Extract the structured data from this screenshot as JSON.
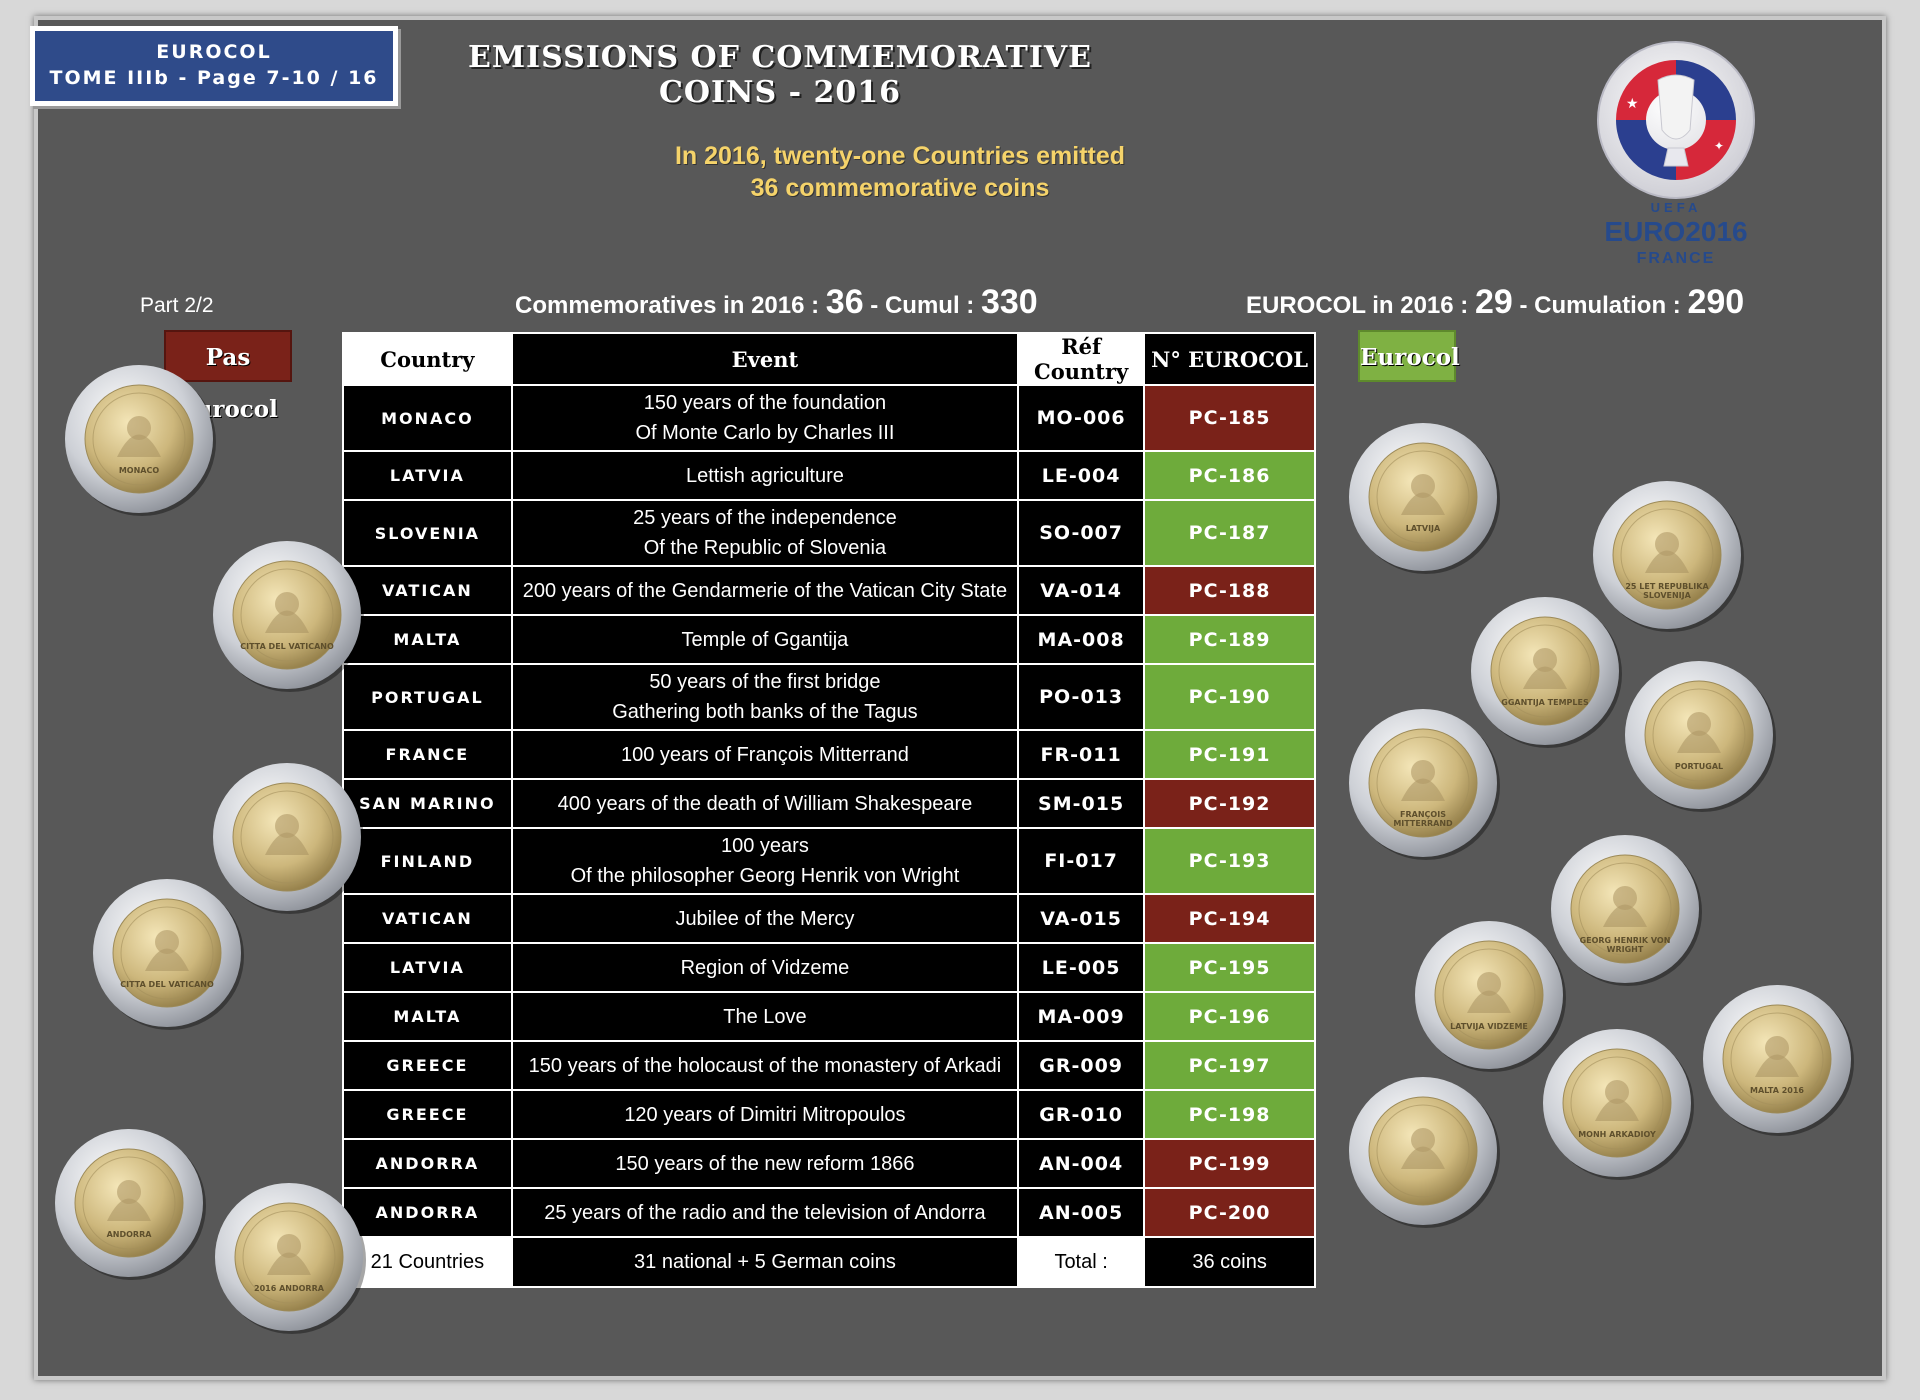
{
  "header": {
    "badge_line1": "EUROCOL",
    "badge_line2": "TOME IIIb - Page 7-10 / 16",
    "title": "EMISSIONS OF COMMEMORATIVE COINS - 2016",
    "intro_line1": "In 2016, twenty-one Countries emitted",
    "intro_line2": "36 commemorative coins",
    "logo_uefa": "UEFA",
    "logo_euro": "EURO2016",
    "logo_france": "FRANCE"
  },
  "summary": {
    "part": "Part 2/2",
    "comm_label": "Commemoratives in 2016 :",
    "comm_value": "36",
    "cumul_label": "- Cumul :",
    "cumul_value": "330",
    "eurocol_label": "EUROCOL in 2016 :",
    "eurocol_value": "29",
    "cumulation_label": "- Cumulation :",
    "cumulation_value": "290"
  },
  "tags": {
    "not_eurocol": "Pas Eurocol",
    "eurocol": "Eurocol"
  },
  "table": {
    "headers": {
      "country": "Country",
      "event": "Event",
      "ref": "Réf Country",
      "num": "N° EUROCOL"
    },
    "rows": [
      {
        "country": "MONACO",
        "event": [
          "150 years of the foundation",
          "Of Monte Carlo by Charles III"
        ],
        "ref": "MO-006",
        "num": "PC-185",
        "status": "red"
      },
      {
        "country": "LATVIA",
        "event": [
          "Lettish agriculture"
        ],
        "ref": "LE-004",
        "num": "PC-186",
        "status": "green"
      },
      {
        "country": "SLOVENIA",
        "event": [
          "25 years of the independence",
          "Of the Republic of Slovenia"
        ],
        "ref": "SO-007",
        "num": "PC-187",
        "status": "green"
      },
      {
        "country": "VATICAN",
        "event": [
          "200 years of the Gendarmerie of the Vatican City State"
        ],
        "ref": "VA-014",
        "num": "PC-188",
        "status": "red"
      },
      {
        "country": "MALTA",
        "event": [
          "Temple of Ggantija"
        ],
        "ref": "MA-008",
        "num": "PC-189",
        "status": "green"
      },
      {
        "country": "PORTUGAL",
        "event": [
          "50 years of the first bridge",
          "Gathering both banks of the Tagus"
        ],
        "ref": "PO-013",
        "num": "PC-190",
        "status": "green"
      },
      {
        "country": "FRANCE",
        "event": [
          "100 years of François Mitterrand"
        ],
        "ref": "FR-011",
        "num": "PC-191",
        "status": "green"
      },
      {
        "country": "SAN MARINO",
        "event": [
          "400 years of the death of William Shakespeare"
        ],
        "ref": "SM-015",
        "num": "PC-192",
        "status": "red"
      },
      {
        "country": "FINLAND",
        "event": [
          "100 years",
          "Of the philosopher Georg Henrik von Wright"
        ],
        "ref": "FI-017",
        "num": "PC-193",
        "status": "green"
      },
      {
        "country": "VATICAN",
        "event": [
          "Jubilee of the Mercy"
        ],
        "ref": "VA-015",
        "num": "PC-194",
        "status": "red"
      },
      {
        "country": "LATVIA",
        "event": [
          "Region of Vidzeme"
        ],
        "ref": "LE-005",
        "num": "PC-195",
        "status": "green"
      },
      {
        "country": "MALTA",
        "event": [
          "The Love"
        ],
        "ref": "MA-009",
        "num": "PC-196",
        "status": "green"
      },
      {
        "country": "GREECE",
        "event": [
          "150 years of the holocaust of the monastery of Arkadi"
        ],
        "ref": "GR-009",
        "num": "PC-197",
        "status": "green"
      },
      {
        "country": "GREECE",
        "event": [
          "120 years of Dimitri Mitropoulos"
        ],
        "ref": "GR-010",
        "num": "PC-198",
        "status": "green"
      },
      {
        "country": "ANDORRA",
        "event": [
          "150 years of the new reform 1866"
        ],
        "ref": "AN-004",
        "num": "PC-199",
        "status": "red"
      },
      {
        "country": "ANDORRA",
        "event": [
          "25 years of the radio and the television of Andorra"
        ],
        "ref": "AN-005",
        "num": "PC-200",
        "status": "red"
      }
    ],
    "total": {
      "countries": "21 Countries",
      "coins_detail": "31 national + 5 German coins",
      "label": "Total :",
      "value": "36 coins"
    }
  },
  "coins": {
    "left": [
      {
        "name": "coin-monaco",
        "text": "MONACO"
      },
      {
        "name": "coin-vatican-gendarmerie",
        "text": "CITTA DEL VATICANO"
      },
      {
        "name": "coin-san-marino",
        "text": ""
      },
      {
        "name": "coin-vatican-mercy",
        "text": "CITTA DEL VATICANO"
      },
      {
        "name": "coin-andorra-reform",
        "text": "ANDORRA"
      },
      {
        "name": "coin-andorra-radio",
        "text": "2016 ANDORRA"
      }
    ],
    "right": [
      {
        "name": "coin-latvia-agriculture",
        "text": "LATVIJA"
      },
      {
        "name": "coin-slovenia",
        "text": "25 LET REPUBLIKA SLOVENIJA"
      },
      {
        "name": "coin-malta-ggantija",
        "text": "GGANTIJA TEMPLES"
      },
      {
        "name": "coin-portugal",
        "text": "PORTUGAL"
      },
      {
        "name": "coin-france",
        "text": "FRANÇOIS MITTERRAND"
      },
      {
        "name": "coin-finland",
        "text": "GEORG HENRIK VON WRIGHT"
      },
      {
        "name": "coin-latvia-vidzeme",
        "text": "LATVIJA VIDZEME"
      },
      {
        "name": "coin-malta-love",
        "text": "MALTA 2016"
      },
      {
        "name": "coin-greece-mitropoulos",
        "text": ""
      },
      {
        "name": "coin-greece-arkadi",
        "text": "MONH ARKADIOY"
      }
    ]
  }
}
